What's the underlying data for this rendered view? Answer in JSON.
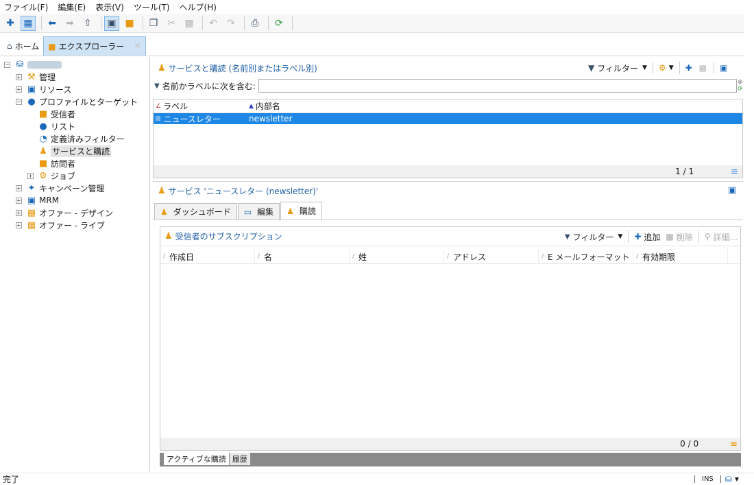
{
  "menu": [
    "ファイル(F)",
    "編集(E)",
    "表示(V)",
    "ツール(T)",
    "ヘルプ(H)"
  ],
  "tabs": {
    "home": "ホーム",
    "explorer": "エクスプローラー"
  },
  "tree": {
    "admin": "管理",
    "resources": "リソース",
    "profiles": "プロファイルとターゲット",
    "recipients": "受信者",
    "lists": "リスト",
    "predefined_filters": "定義済みフィルター",
    "services": "サービスと購読",
    "visitors": "訪問者",
    "jobs": "ジョブ",
    "campaigns": "キャンペーン管理",
    "mrm": "MRM",
    "offer_design": "オファー - デザイン",
    "offer_live": "オファー - ライブ"
  },
  "top_pane": {
    "title": "サービスと購読 (名前別またはラベル別)",
    "filter_label": "フィルター",
    "search_label": "名前かラベルに次を含む:",
    "search_value": "",
    "columns": [
      "ラベル",
      "内部名"
    ],
    "rows": [
      {
        "label": "ニュースレター",
        "internal_name": "newsletter"
      }
    ],
    "count": "1 / 1"
  },
  "detail": {
    "title": "サービス 'ニュースレター (newsletter)'",
    "tabs": [
      "ダッシュボード",
      "編集",
      "購読"
    ],
    "subscriptions": {
      "title": "受信者のサブスクリプション",
      "filter_label": "フィルター",
      "add_label": "追加",
      "delete_label": "削除",
      "details_label": "詳細...",
      "columns": [
        "作成日",
        "名",
        "姓",
        "アドレス",
        "E メールフォーマット",
        "有効期限"
      ],
      "count": "0 / 0"
    },
    "bottom_tabs": [
      "アクティブな購読",
      "履歴"
    ]
  },
  "status": {
    "text": "完了",
    "mode": "INS"
  }
}
